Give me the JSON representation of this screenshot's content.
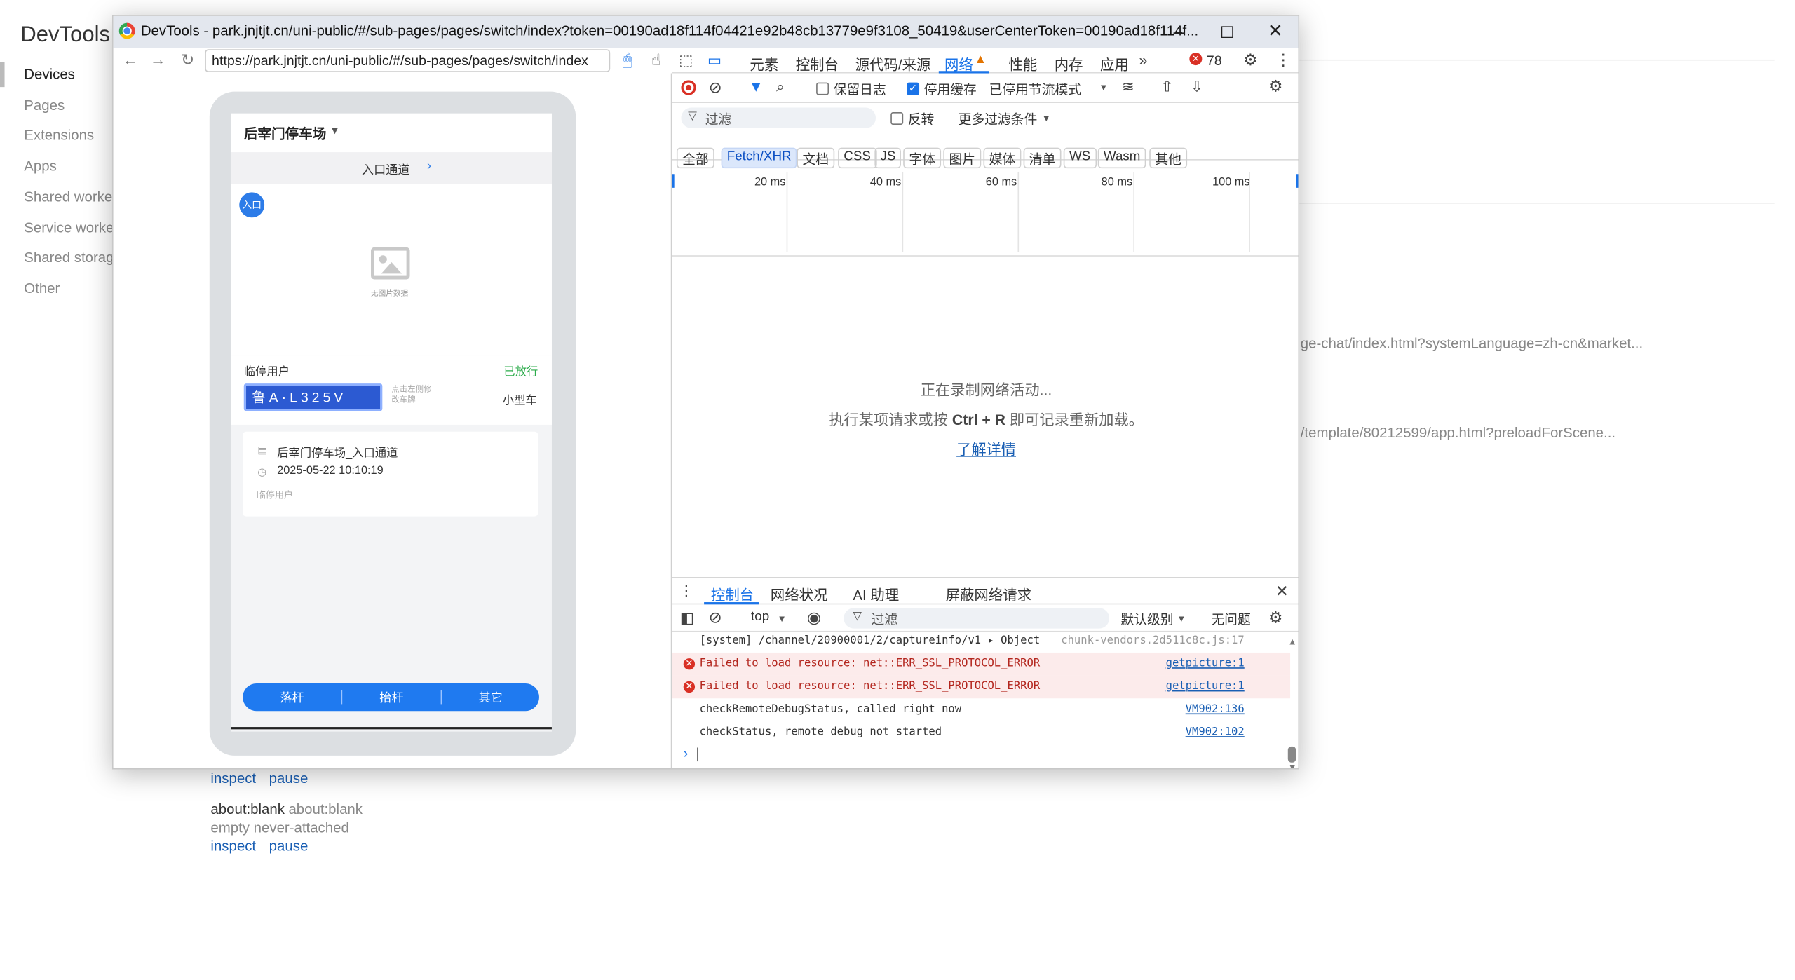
{
  "background": {
    "title": "DevTools",
    "nav": [
      "Devices",
      "Pages",
      "Extensions",
      "Apps",
      "Shared workers",
      "Service workers",
      "Shared storage",
      "Other"
    ],
    "active_nav": "Devices",
    "url_frag_1": "ge-chat/index.html?systemLanguage=zh-cn&market...",
    "url_frag_2": "/template/80212599/app.html?preloadForScene...",
    "inspect": "inspect",
    "pause": "pause",
    "about_title": "about:blank",
    "about_url": "about:blank",
    "about_status": "empty never-attached"
  },
  "window": {
    "title": "DevTools - park.jnjtjt.cn/uni-public/#/sub-pages/pages/switch/index?token=00190ad18f114f04421e92b48cb13779e9f3108_50419&userCenterToken=00190ad18f114f...",
    "url": "https://park.jnjtjt.cn/uni-public/#/sub-pages/pages/switch/index"
  },
  "app": {
    "lot_name": "后宰门停车场",
    "channel": "入口通道",
    "entry_badge": "入口",
    "no_image": "无图片数据",
    "user_type": "临停用户",
    "status": "已放行",
    "plate": "鲁A·L325V",
    "plate_hint": "点击左侧修改车牌",
    "vehicle_type": "小型车",
    "record_location": "后宰门停车场_入口通道",
    "record_time": "2025-05-22 10:10:19",
    "record_user": "临停用户",
    "actions": [
      "落杆",
      "抬杆",
      "其它"
    ]
  },
  "devtools": {
    "tabs": [
      "元素",
      "控制台",
      "源代码/来源",
      "网络",
      "性能",
      "内存",
      "应用"
    ],
    "active_tab": "网络",
    "error_count": "78",
    "preserve_log": "保留日志",
    "disable_cache": "停用缓存",
    "throttle": "已停用节流模式",
    "filter_placeholder": "过滤",
    "invert": "反转",
    "more_filters": "更多过滤条件",
    "type_filters": [
      "全部",
      "Fetch/XHR",
      "文档",
      "CSS",
      "JS",
      "字体",
      "图片",
      "媒体",
      "清单",
      "WS",
      "Wasm",
      "其他"
    ],
    "active_type": "Fetch/XHR",
    "timeline_ticks": [
      "20 ms",
      "40 ms",
      "60 ms",
      "80 ms",
      "100 ms"
    ],
    "recording_1": "正在录制网络活动...",
    "recording_2_pre": "执行某项请求或按",
    "recording_2_key": "Ctrl + R",
    "recording_2_post": "即可记录重新加载。",
    "learn_more": "了解详情",
    "drawer_tabs": [
      "控制台",
      "网络状况",
      "AI 助理",
      "屏蔽网络请求"
    ],
    "context": "top",
    "console_filter": "过滤",
    "level": "默认级别",
    "no_issues": "无问题",
    "console_lines": [
      {
        "text": "[system] /channel/20900001/2/captureinfo/v1   ▸ Object",
        "src": "chunk-vendors.2d511c8c.js:17",
        "type": "log"
      },
      {
        "text": "Failed to load resource: net::ERR_SSL_PROTOCOL_ERROR",
        "src": "getpicture:1",
        "type": "error"
      },
      {
        "text": "Failed to load resource: net::ERR_SSL_PROTOCOL_ERROR",
        "src": "getpicture:1",
        "type": "error"
      },
      {
        "text": "checkRemoteDebugStatus, called right now",
        "src": "VM902:136",
        "type": "log"
      },
      {
        "text": "checkStatus, remote debug not started",
        "src": "VM902:102",
        "type": "log"
      }
    ]
  }
}
